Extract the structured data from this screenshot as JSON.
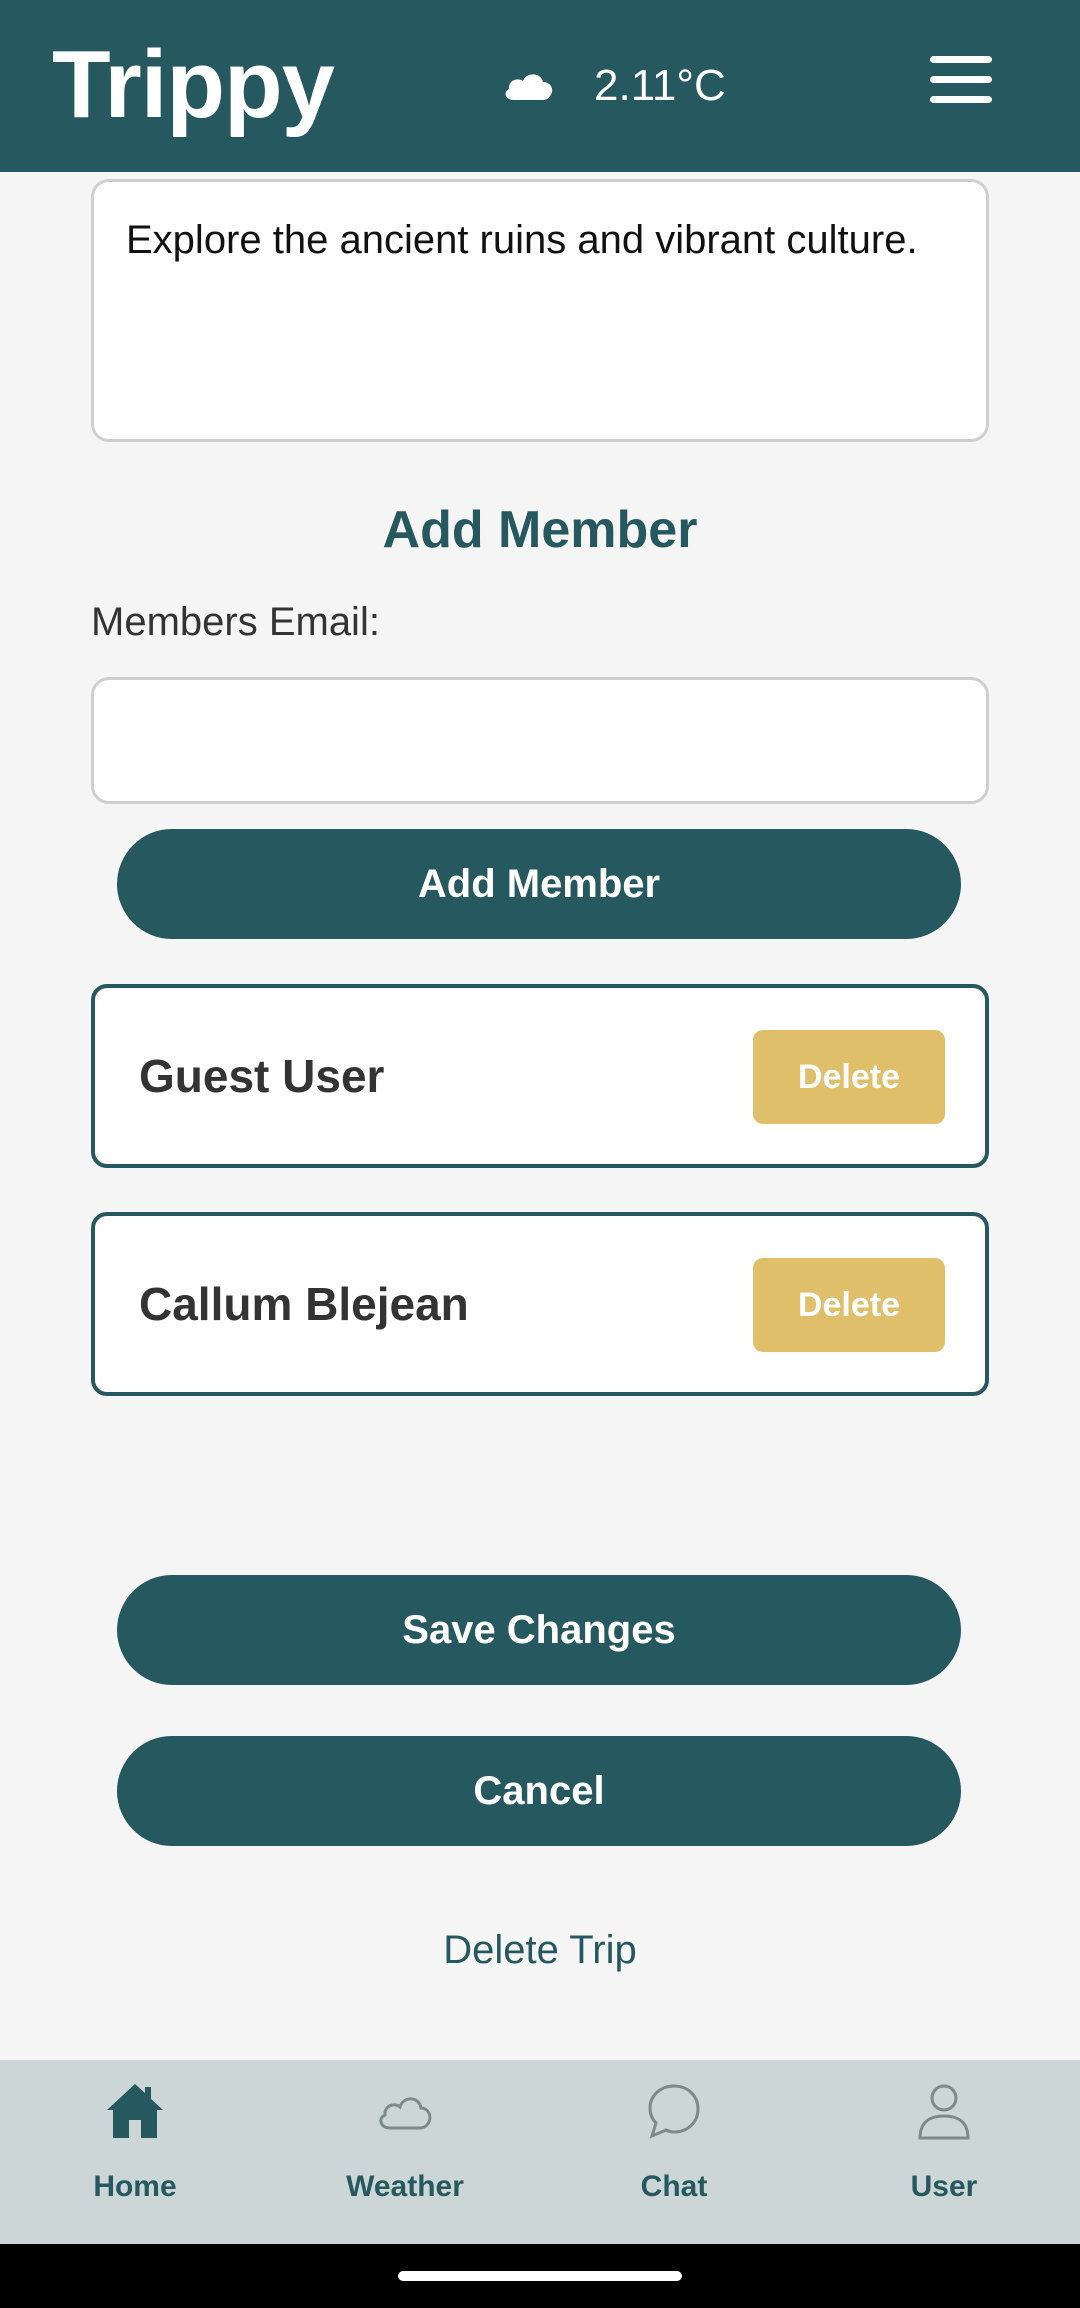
{
  "header": {
    "app_title": "Trippy",
    "weather_icon": "cloud-icon",
    "temperature": "2.11°C",
    "menu_icon": "hamburger-menu-icon"
  },
  "trip": {
    "description": "Explore the ancient ruins and vibrant culture."
  },
  "add_member": {
    "section_title": "Add Member",
    "email_label": "Members Email:",
    "email_value": "",
    "email_placeholder": "",
    "button_label": "Add Member"
  },
  "members": [
    {
      "name": "Guest User",
      "delete_label": "Delete"
    },
    {
      "name": "Callum Blejean",
      "delete_label": "Delete"
    }
  ],
  "actions": {
    "save_label": "Save Changes",
    "cancel_label": "Cancel",
    "delete_trip_label": "Delete Trip"
  },
  "bottom_nav": [
    {
      "label": "Home",
      "icon": "home-icon",
      "active": true
    },
    {
      "label": "Weather",
      "icon": "cloud-icon",
      "active": false
    },
    {
      "label": "Chat",
      "icon": "chat-bubble-icon",
      "active": false
    },
    {
      "label": "User",
      "icon": "user-icon",
      "active": false
    }
  ],
  "colors": {
    "primary": "#26585f",
    "accent": "#dfbf69",
    "background": "#f5f5f5",
    "nav_background": "#ccd6d6"
  }
}
